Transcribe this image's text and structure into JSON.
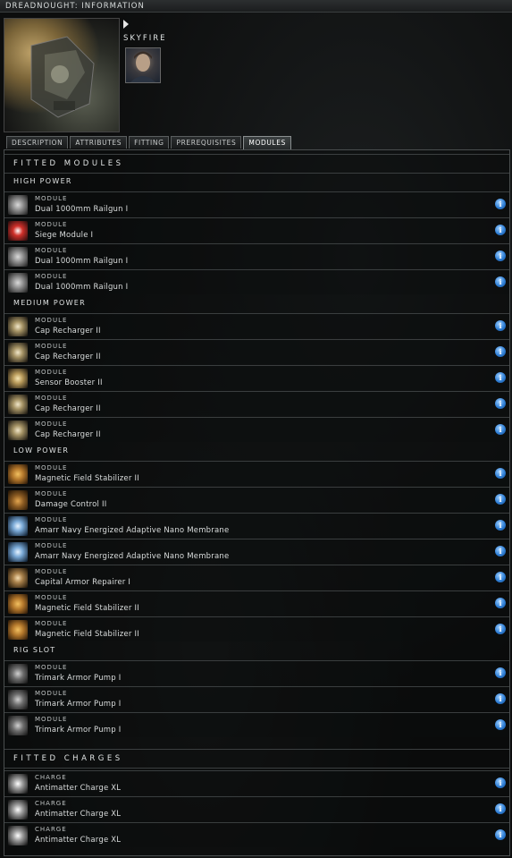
{
  "window": {
    "title": "DREADNOUGHT: INFORMATION"
  },
  "pilot": {
    "name": "SKYFIRE"
  },
  "tabs": [
    {
      "label": "DESCRIPTION",
      "active": false
    },
    {
      "label": "ATTRIBUTES",
      "active": false
    },
    {
      "label": "FITTING",
      "active": false
    },
    {
      "label": "PREREQUISITES",
      "active": false
    },
    {
      "label": "MODULES",
      "active": true
    }
  ],
  "fitted_modules_title": "FITTED MODULES",
  "fitted_charges_title": "FITTED CHARGES",
  "sections": [
    {
      "title": "HIGH POWER",
      "items": [
        {
          "type": "MODULE",
          "name": "Dual 1000mm Railgun I",
          "icon": "railgun-icon"
        },
        {
          "type": "MODULE",
          "name": "Siege Module I",
          "icon": "siege-module-icon"
        },
        {
          "type": "MODULE",
          "name": "Dual 1000mm Railgun I",
          "icon": "railgun-icon"
        },
        {
          "type": "MODULE",
          "name": "Dual 1000mm Railgun I",
          "icon": "railgun-icon"
        }
      ]
    },
    {
      "title": "MEDIUM POWER",
      "items": [
        {
          "type": "MODULE",
          "name": "Cap Recharger II",
          "icon": "cap-recharger-icon"
        },
        {
          "type": "MODULE",
          "name": "Cap Recharger II",
          "icon": "cap-recharger-icon"
        },
        {
          "type": "MODULE",
          "name": "Sensor Booster II",
          "icon": "sensor-booster-icon"
        },
        {
          "type": "MODULE",
          "name": "Cap Recharger II",
          "icon": "cap-recharger-icon"
        },
        {
          "type": "MODULE",
          "name": "Cap Recharger II",
          "icon": "cap-recharger-icon"
        }
      ]
    },
    {
      "title": "LOW POWER",
      "items": [
        {
          "type": "MODULE",
          "name": "Magnetic Field Stabilizer II",
          "icon": "magnetic-stabilizer-icon"
        },
        {
          "type": "MODULE",
          "name": "Damage Control II",
          "icon": "damage-control-icon"
        },
        {
          "type": "MODULE",
          "name": "Amarr Navy Energized Adaptive Nano Membrane",
          "icon": "nano-membrane-icon"
        },
        {
          "type": "MODULE",
          "name": "Amarr Navy Energized Adaptive Nano Membrane",
          "icon": "nano-membrane-icon"
        },
        {
          "type": "MODULE",
          "name": "Capital Armor Repairer I",
          "icon": "armor-repairer-icon"
        },
        {
          "type": "MODULE",
          "name": "Magnetic Field Stabilizer II",
          "icon": "magnetic-stabilizer-icon"
        },
        {
          "type": "MODULE",
          "name": "Magnetic Field Stabilizer II",
          "icon": "magnetic-stabilizer-icon"
        }
      ]
    },
    {
      "title": "RIG SLOT",
      "items": [
        {
          "type": "MODULE",
          "name": "Trimark Armor Pump I",
          "icon": "armor-pump-rig-icon"
        },
        {
          "type": "MODULE",
          "name": "Trimark Armor Pump I",
          "icon": "armor-pump-rig-icon"
        },
        {
          "type": "MODULE",
          "name": "Trimark Armor Pump I",
          "icon": "armor-pump-rig-icon"
        }
      ]
    }
  ],
  "charges": [
    {
      "type": "CHARGE",
      "name": "Antimatter Charge XL",
      "icon": "antimatter-charge-icon"
    },
    {
      "type": "CHARGE",
      "name": "Antimatter Charge XL",
      "icon": "antimatter-charge-icon"
    },
    {
      "type": "CHARGE",
      "name": "Antimatter Charge XL",
      "icon": "antimatter-charge-icon"
    }
  ]
}
